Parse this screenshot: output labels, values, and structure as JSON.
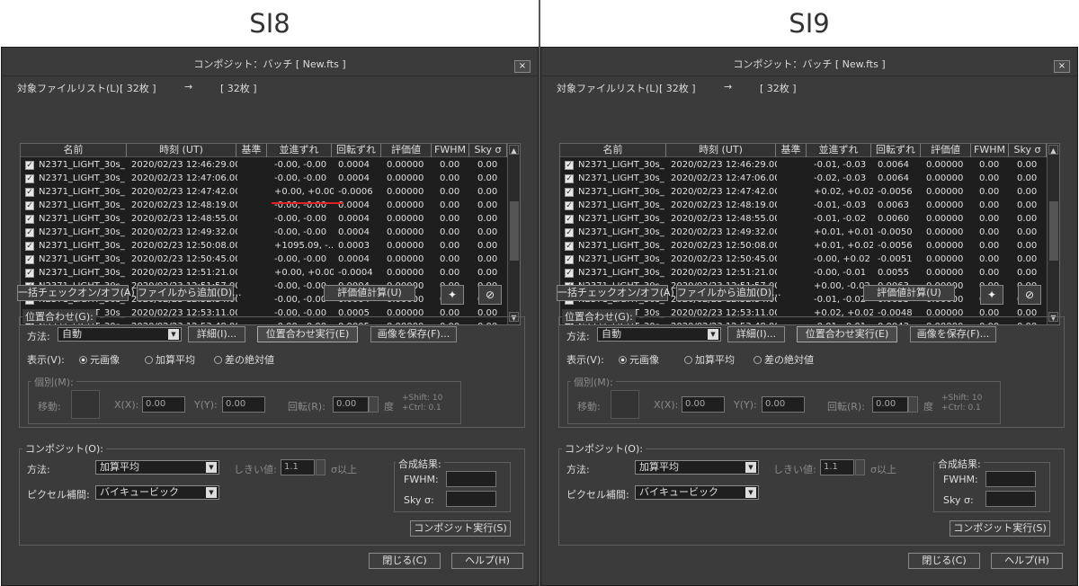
{
  "panels": [
    {
      "caption": "SI8",
      "title": "コンポジット：バッチ [ New.fts ]",
      "close_label": "×",
      "file_list_label": "対象ファイルリスト(L):",
      "count_from": "[ 32枚 ]",
      "arrow": "→",
      "count_to": "[ 32枚 ]",
      "columns": [
        "名前",
        "時刻 (UT)",
        "基準",
        "並進ずれ",
        "回転ずれ",
        "評価値",
        "FWHM",
        "Sky σ"
      ],
      "rows": [
        {
          "name": "N2371_LIGHT_30s_...",
          "time": "2020/02/23 12:46:29.00",
          "base": "",
          "shift": "-0.00, -0.00",
          "rot": "0.0004",
          "eval": "0.00000",
          "fwhm": "0.00",
          "sky": "0.00"
        },
        {
          "name": "N2371_LIGHT_30s_...",
          "time": "2020/02/23 12:47:06.00",
          "base": "",
          "shift": "-0.00, -0.00",
          "rot": "0.0004",
          "eval": "0.00000",
          "fwhm": "0.00",
          "sky": "0.00"
        },
        {
          "name": "N2371_LIGHT_30s_...",
          "time": "2020/02/23 12:47:42.00",
          "base": "",
          "shift": "+0.00, +0.00",
          "rot": "-0.0006",
          "eval": "0.00000",
          "fwhm": "0.00",
          "sky": "0.00"
        },
        {
          "name": "N2371_LIGHT_30s_...",
          "time": "2020/02/23 12:48:19.00",
          "base": "",
          "shift": "-0.00, -0.00",
          "rot": "0.0004",
          "eval": "0.00000",
          "fwhm": "0.00",
          "sky": "0.00"
        },
        {
          "name": "N2371_LIGHT_30s_...",
          "time": "2020/02/23 12:48:55.00",
          "base": "",
          "shift": "-0.00, -0.00",
          "rot": "0.0004",
          "eval": "0.00000",
          "fwhm": "0.00",
          "sky": "0.00"
        },
        {
          "name": "N2371_LIGHT_30s_...",
          "time": "2020/02/23 12:49:32.00",
          "base": "",
          "shift": "-0.00, -0.00",
          "rot": "0.0004",
          "eval": "0.00000",
          "fwhm": "0.00",
          "sky": "0.00"
        },
        {
          "name": "N2371_LIGHT_30s_...",
          "time": "2020/02/23 12:50:08.00",
          "base": "",
          "shift": "+1095.09, -...",
          "rot": "0.0003",
          "eval": "0.00000",
          "fwhm": "0.00",
          "sky": "0.00"
        },
        {
          "name": "N2371_LIGHT_30s_...",
          "time": "2020/02/23 12:50:45.00",
          "base": "",
          "shift": "-0.00, -0.00",
          "rot": "0.0004",
          "eval": "0.00000",
          "fwhm": "0.00",
          "sky": "0.00"
        },
        {
          "name": "N2371_LIGHT_30s_...",
          "time": "2020/02/23 12:51:21.00",
          "base": "",
          "shift": "+0.00, +0.00",
          "rot": "-0.0004",
          "eval": "0.00000",
          "fwhm": "0.00",
          "sky": "0.00"
        },
        {
          "name": "N2371_LIGHT_30s_...",
          "time": "2020/02/23 12:51:57.00",
          "base": "",
          "shift": "-0.00, -0.00",
          "rot": "0.0004",
          "eval": "0.00000",
          "fwhm": "0.00",
          "sky": "0.00"
        },
        {
          "name": "N2371_LIGHT_30s_...",
          "time": "2020/02/23 12:52:34.00",
          "base": "",
          "shift": "-0.00, -0.00",
          "rot": "0.0004",
          "eval": "0.00000",
          "fwhm": "0.00",
          "sky": "0.00"
        },
        {
          "name": "N2371_LIGHT_30s_...",
          "time": "2020/02/23 12:53:11.00",
          "base": "",
          "shift": "-0.00, -0.00",
          "rot": "0.0005",
          "eval": "0.00000",
          "fwhm": "0.00",
          "sky": "0.00"
        },
        {
          "name": "N2371_LIGHT_30s_...",
          "time": "2020/02/23 12:53:48.00",
          "base": "",
          "shift": "-0.00, -0.00",
          "rot": "0.0005",
          "eval": "0.00000",
          "fwhm": "0.00",
          "sky": "0.00"
        }
      ],
      "btn_toggle_all": "一括チェックオン/オフ(A)",
      "btn_add_file": "ファイルから追加(D)...",
      "btn_eval": "評価値計算(U)",
      "align_group": "位置合わせ(G):",
      "method_label": "方法:",
      "method_value": "自動",
      "btn_detail": "詳細(I)...",
      "btn_run_align": "位置合わせ実行(E)",
      "btn_save_image": "画像を保存(F)...",
      "display_label": "表示(V):",
      "radio_original": "元画像",
      "radio_add_avg": "加算平均",
      "radio_abs_diff": "差の絶対値",
      "individual_group": "個別(M):",
      "move_label": "移動:",
      "x_label": "X(X):",
      "x_value": "0.00",
      "y_label": "Y(Y):",
      "y_value": "0.00",
      "rot_label": "回転(R):",
      "rot_value": "0.00",
      "deg_label": "度",
      "shift_hint": "+Shift: 10",
      "ctrl_hint": "+Ctrl: 0.1",
      "composite_group": "コンポジット(O):",
      "comp_method_label": "方法:",
      "comp_method_value": "加算平均",
      "threshold_label": "しきい値:",
      "threshold_value": "1.1",
      "sigma_label": "σ以上",
      "interp_label": "ピクセル補間:",
      "interp_value": "バイキュービック",
      "result_group": "合成結果:",
      "fwhm_label": "FWHM:",
      "sky_label": "Sky σ:",
      "btn_run_composite": "コンポジット実行(S)",
      "btn_close": "閉じる(C)",
      "btn_help": "ヘルプ(H)"
    },
    {
      "caption": "SI9",
      "title": "コンポジット：バッチ [ New.fts ]",
      "close_label": "×",
      "file_list_label": "対象ファイルリスト(L):",
      "count_from": "[ 32枚 ]",
      "arrow": "→",
      "count_to": "[ 32枚 ]",
      "columns": [
        "名前",
        "時刻 (UT)",
        "基準",
        "並進ずれ",
        "回転ずれ",
        "評価値",
        "FWHM",
        "Sky σ"
      ],
      "rows": [
        {
          "name": "N2371_LIGHT_30s_...",
          "time": "2020/02/23 12:46:29.00",
          "base": "",
          "shift": "-0.01, -0.03",
          "rot": "0.0064",
          "eval": "0.00000",
          "fwhm": "0.00",
          "sky": "0.00"
        },
        {
          "name": "N2371_LIGHT_30s_...",
          "time": "2020/02/23 12:47:06.00",
          "base": "",
          "shift": "-0.02, -0.03",
          "rot": "0.0064",
          "eval": "0.00000",
          "fwhm": "0.00",
          "sky": "0.00"
        },
        {
          "name": "N2371_LIGHT_30s_...",
          "time": "2020/02/23 12:47:42.00",
          "base": "",
          "shift": "+0.02, +0.02",
          "rot": "-0.0056",
          "eval": "0.00000",
          "fwhm": "0.00",
          "sky": "0.00"
        },
        {
          "name": "N2371_LIGHT_30s_...",
          "time": "2020/02/23 12:48:19.00",
          "base": "",
          "shift": "-0.01, -0.03",
          "rot": "0.0063",
          "eval": "0.00000",
          "fwhm": "0.00",
          "sky": "0.00"
        },
        {
          "name": "N2371_LIGHT_30s_...",
          "time": "2020/02/23 12:48:55.00",
          "base": "",
          "shift": "-0.01, -0.02",
          "rot": "0.0060",
          "eval": "0.00000",
          "fwhm": "0.00",
          "sky": "0.00"
        },
        {
          "name": "N2371_LIGHT_30s_...",
          "time": "2020/02/23 12:49:32.00",
          "base": "",
          "shift": "+0.01, +0.01",
          "rot": "-0.0050",
          "eval": "0.00000",
          "fwhm": "0.00",
          "sky": "0.00"
        },
        {
          "name": "N2371_LIGHT_30s_...",
          "time": "2020/02/23 12:50:08.00",
          "base": "",
          "shift": "+0.01, +0.02",
          "rot": "-0.0056",
          "eval": "0.00000",
          "fwhm": "0.00",
          "sky": "0.00"
        },
        {
          "name": "N2371_LIGHT_30s_...",
          "time": "2020/02/23 12:50:45.00",
          "base": "",
          "shift": "-0.00, +0.02",
          "rot": "-0.0051",
          "eval": "0.00000",
          "fwhm": "0.00",
          "sky": "0.00"
        },
        {
          "name": "N2371_LIGHT_30s_...",
          "time": "2020/02/23 12:51:21.00",
          "base": "",
          "shift": "-0.00, -0.01",
          "rot": "0.0055",
          "eval": "0.00000",
          "fwhm": "0.00",
          "sky": "0.00"
        },
        {
          "name": "N2371_LIGHT_30s_...",
          "time": "2020/02/23 12:51:57.00",
          "base": "",
          "shift": "+0.00, -0.02",
          "rot": "0.0063",
          "eval": "0.00000",
          "fwhm": "0.00",
          "sky": "0.00"
        },
        {
          "name": "N2371_LIGHT_30s_...",
          "time": "2020/02/23 12:52:34.00",
          "base": "",
          "shift": "-0.01, -0.02",
          "rot": "0.0053",
          "eval": "0.00000",
          "fwhm": "0.00",
          "sky": "0.00"
        },
        {
          "name": "N2371_LIGHT_30s_...",
          "time": "2020/02/23 12:53:11.00",
          "base": "",
          "shift": "+0.02, +0.02",
          "rot": "-0.0048",
          "eval": "0.00000",
          "fwhm": "0.00",
          "sky": "0.00"
        },
        {
          "name": "N2371_LIGHT_30s_...",
          "time": "2020/02/23 12:53:48.00",
          "base": "",
          "shift": "-0.01, -0.01",
          "rot": "0.0043",
          "eval": "0.00000",
          "fwhm": "0.00",
          "sky": "0.00"
        }
      ],
      "btn_toggle_all": "一括チェックオン/オフ(A)",
      "btn_add_file": "ファイルから追加(D)...",
      "btn_eval": "評価値計算(U)",
      "align_group": "位置合わせ(G):",
      "method_label": "方法:",
      "method_value": "自動",
      "btn_detail": "詳細(I)...",
      "btn_run_align": "位置合わせ実行(E)",
      "btn_save_image": "画像を保存(F)...",
      "display_label": "表示(V):",
      "radio_original": "元画像",
      "radio_add_avg": "加算平均",
      "radio_abs_diff": "差の絶対値",
      "individual_group": "個別(M):",
      "move_label": "移動:",
      "x_label": "X(X):",
      "x_value": "0.00",
      "y_label": "Y(Y):",
      "y_value": "0.00",
      "rot_label": "回転(R):",
      "rot_value": "0.00",
      "deg_label": "度",
      "shift_hint": "+Shift: 10",
      "ctrl_hint": "+Ctrl: 0.1",
      "composite_group": "コンポジット(O):",
      "comp_method_label": "方法:",
      "comp_method_value": "加算平均",
      "threshold_label": "しきい値:",
      "threshold_value": "1.1",
      "sigma_label": "σ以上",
      "interp_label": "ピクセル補間:",
      "interp_value": "バイキュービック",
      "result_group": "合成結果:",
      "fwhm_label": "FWHM:",
      "sky_label": "Sky σ:",
      "btn_run_composite": "コンポジット実行(S)",
      "btn_close": "閉じる(C)",
      "btn_help": "ヘルプ(H)"
    }
  ]
}
